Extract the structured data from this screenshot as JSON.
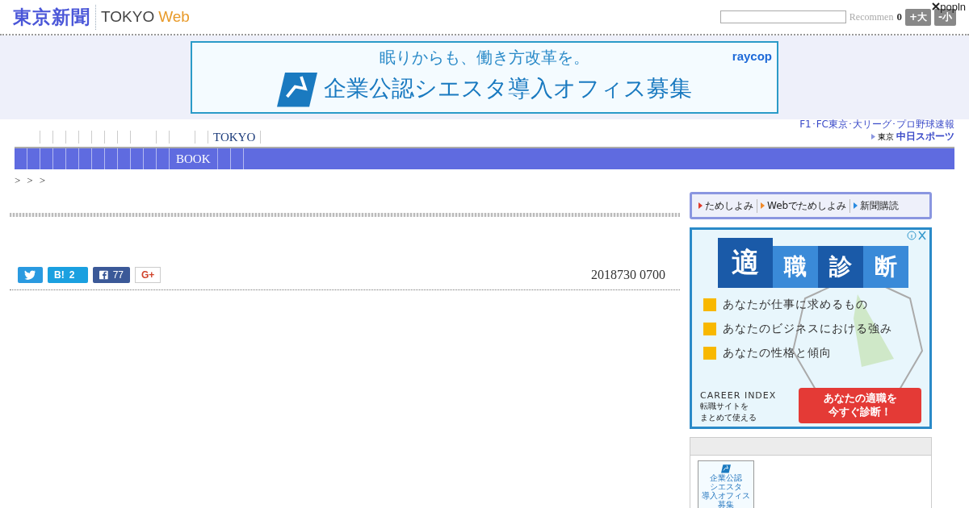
{
  "header": {
    "logo": "東京新聞",
    "brand": "TOKYO",
    "brand_accent": "Web",
    "recommend": "Recommen",
    "count": "0",
    "font_buttons": [
      "+大",
      "-小"
    ],
    "popln": "popln"
  },
  "banner": {
    "headline": "眠りからも、働き方改革を。",
    "title": "企業公認シエスタ導入オフィス募集",
    "brand": "raycop"
  },
  "nav": {
    "items": [
      {
        "label": "TOKYO"
      }
    ],
    "sports_caption": "F1･FC東京･大リーグ･プロ野球速報",
    "sports_prefix": "東京",
    "sports_name": "中日スポーツ"
  },
  "subnav": {
    "items": [
      {
        "label": "BOOK"
      }
    ]
  },
  "breadcrumb": [
    ">",
    ">",
    ">"
  ],
  "share": {
    "hatena_count": "2",
    "facebook_count": "77",
    "gplus": "G+",
    "hatena": "B!"
  },
  "date": "2018730 0700",
  "subscribe": [
    {
      "label": "ためしよみ",
      "color": "#e03a2a"
    },
    {
      "label": "Webでためしよみ",
      "color": "#f08a2a"
    },
    {
      "label": "新聞購読",
      "color": "#2a8ae0"
    }
  ],
  "ad": {
    "title": [
      "適",
      "職",
      "診",
      "断"
    ],
    "bullets": [
      "あなたが仕事に求めるもの",
      "あなたのビジネスにおける強み",
      "あなたの性格と傾向"
    ],
    "brand": "CAREER INDEX",
    "tagline": [
      "転職サイトを",
      "まとめて使える"
    ],
    "cta": [
      "あなたの適職を",
      "今すぐ診断！"
    ]
  },
  "thumb": {
    "lines": [
      "企業公認",
      "シエスタ",
      "導入オフィス",
      "募集"
    ]
  }
}
